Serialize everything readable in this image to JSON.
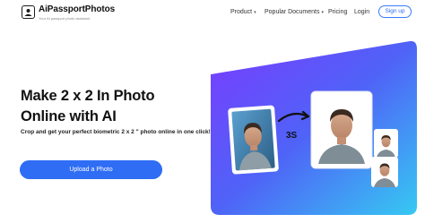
{
  "brand": {
    "name": "AiPassportPhotos",
    "tagline": "Your AI passport photo assistant"
  },
  "nav": {
    "items": [
      {
        "label": "Product",
        "dropdown": true
      },
      {
        "label": "Popular Documents",
        "dropdown": true
      },
      {
        "label": "Pricing",
        "dropdown": false
      },
      {
        "label": "Login",
        "dropdown": false
      }
    ],
    "signup_label": "Sign up"
  },
  "hero": {
    "title_line1": "Make 2 x 2 In Photo",
    "title_line2": "Online with AI",
    "subtitle": "Crop and get your perfect biometric 2 x 2 \" photo online in one click!",
    "cta_label": "Upload a Photo",
    "timer_label": "3S"
  },
  "colors": {
    "accent": "#2f6df5",
    "gradient_start": "#6b4bff",
    "gradient_end": "#39c6f3"
  }
}
